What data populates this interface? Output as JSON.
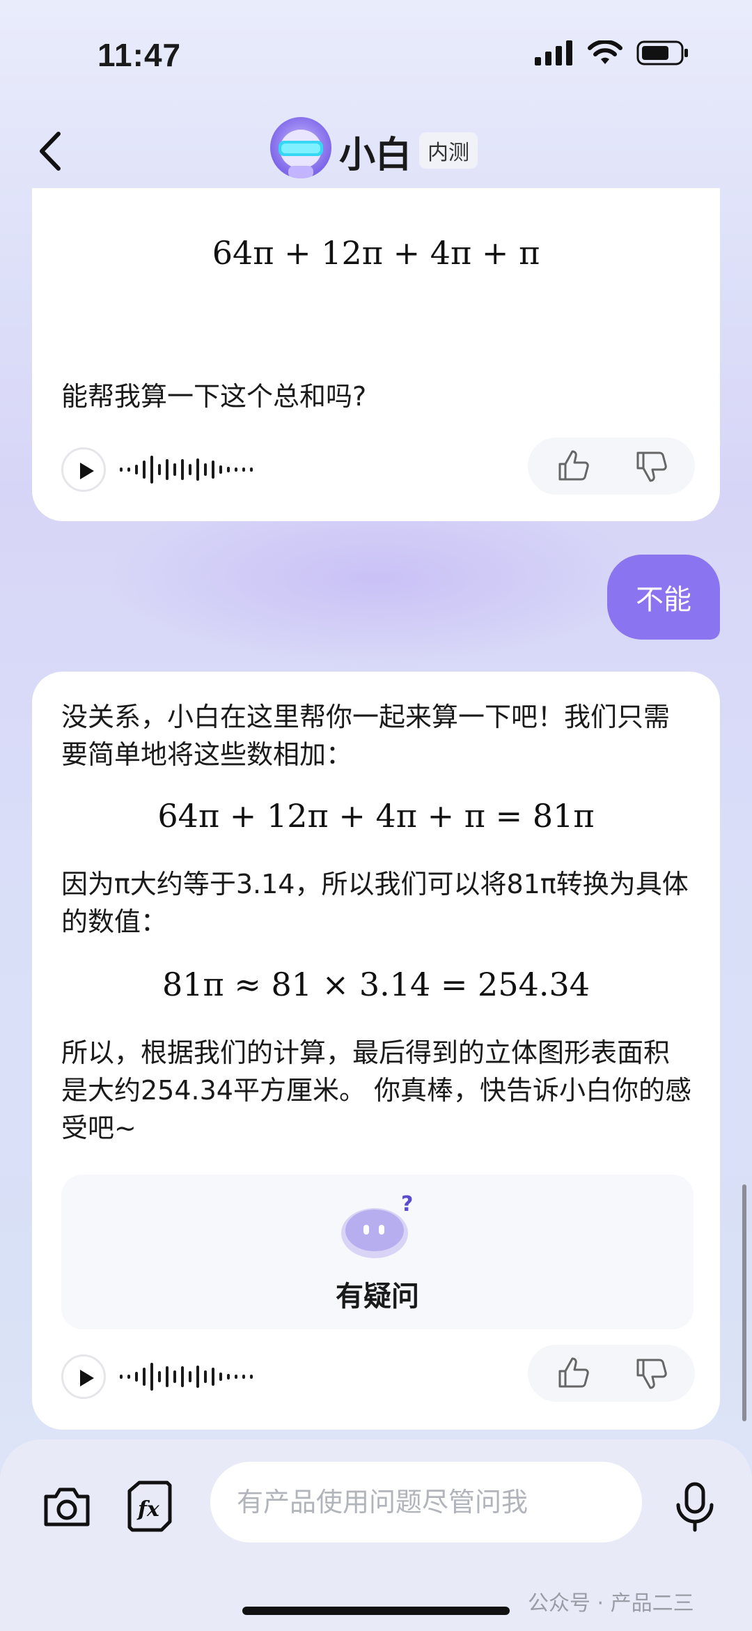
{
  "status": {
    "time": "11:47"
  },
  "header": {
    "title": "小白",
    "badge": "内测"
  },
  "messages": {
    "first_ai": {
      "formula": "64π + 12π + 4π + π",
      "question": "能帮我算一下这个总和吗?"
    },
    "user": {
      "text": "不能"
    },
    "second_ai": {
      "para1": "没关系，小白在这里帮你一起来算一下吧！我们只需要简单地将这些数相加：",
      "formula1": "64π + 12π + 4π + π = 81π",
      "para2": "因为π大约等于3.14，所以我们可以将81π转换为具体的数值：",
      "formula2": "81π ≈ 81 × 3.14 = 254.34",
      "para3": "所以，根据我们的计算，最后得到的立体图形表面积是大约254.34平方厘米。 你真棒，快告诉小白你的感受吧~",
      "doubt_label": "有疑问"
    }
  },
  "input": {
    "placeholder": "有产品使用问题尽管问我"
  },
  "watermark": "公众号 · 产品二三",
  "colors": {
    "accent": "#8a74ef"
  },
  "icons": [
    "back-icon",
    "camera-icon",
    "formula-icon",
    "microphone-icon",
    "thumbs-up-icon",
    "thumbs-down-icon",
    "play-icon"
  ]
}
